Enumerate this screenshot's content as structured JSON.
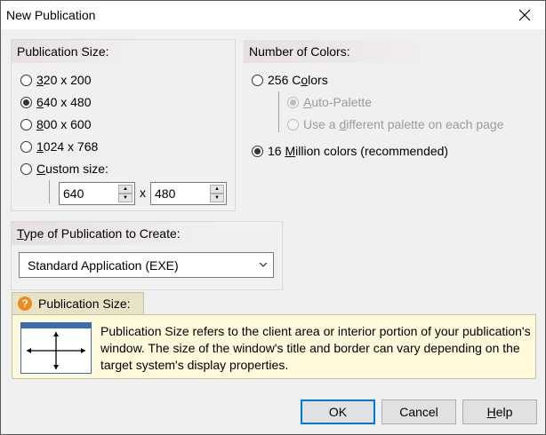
{
  "window": {
    "title": "New Publication",
    "close_icon": "close-icon"
  },
  "publication_size": {
    "header": "Publication Size:",
    "options": [
      {
        "pre": "",
        "u": "3",
        "post": "20 x 200",
        "checked": false
      },
      {
        "pre": "",
        "u": "6",
        "post": "40 x 480",
        "checked": true
      },
      {
        "pre": "",
        "u": "8",
        "post": "00 x 600",
        "checked": false
      },
      {
        "pre": "",
        "u": "1",
        "post": "024 x 768",
        "checked": false
      },
      {
        "pre": "",
        "u": "C",
        "post": "ustom size:",
        "checked": false
      }
    ],
    "custom_width": "640",
    "custom_x": "x",
    "custom_height": "480"
  },
  "colors": {
    "header": "Number of Colors:",
    "opt256": {
      "pre": "256 C",
      "u": "o",
      "post": "lors",
      "checked": false
    },
    "auto_palette": {
      "pre": "",
      "u": "A",
      "post": "uto-Palette",
      "checked": true,
      "disabled": true
    },
    "different_palette": {
      "pre": "Use a ",
      "u": "d",
      "post": "ifferent palette on each page",
      "checked": false,
      "disabled": true
    },
    "opt16m": {
      "pre": "16 ",
      "u": "M",
      "post": "illion colors (recommended)",
      "checked": true
    }
  },
  "type_group": {
    "header_u": "T",
    "header_rest": "ype of Publication to Create:",
    "selected": "Standard Application (EXE)"
  },
  "help": {
    "tab_label": "Publication Size:",
    "icon_char": "?",
    "text": "Publication Size refers to the client area or interior portion of your publication's window. The size of the window's title and border can vary depending on the target system's display properties."
  },
  "buttons": {
    "ok": "OK",
    "cancel": "Cancel",
    "help_u": "H",
    "help_rest": "elp"
  },
  "colors_theme": {
    "accent": "#0078d7",
    "help_bg": "#fff9dc",
    "help_icon": "#f08a1c"
  }
}
